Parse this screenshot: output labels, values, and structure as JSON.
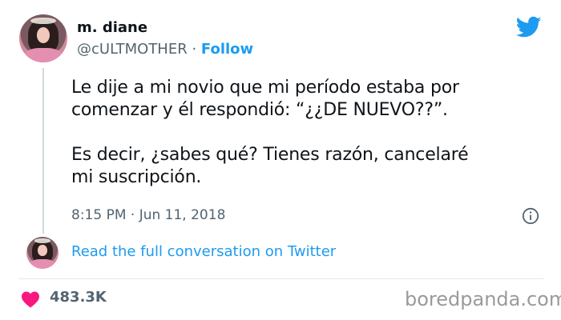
{
  "author": {
    "name": "m. diane",
    "handle": "@cULTMOTHER",
    "separator": " · ",
    "follow_label": "Follow"
  },
  "tweet": {
    "text": "Le dije a mi novio que mi período estaba por\ncomenzar y él respondió: “¿¿DE NUEVO??”.\n\nEs decir, ¿sabes qué? Tienes razón, cancelaré\nmi suscripción.",
    "timestamp": "8:15 PM · Jun 11, 2018"
  },
  "conversation_link": "Read the full conversation on Twitter",
  "likes": "483.3K",
  "watermark": "boredpanda.com",
  "colors": {
    "twitter_blue": "#1d9bf0",
    "heart": "#f91880",
    "muted": "#536471"
  },
  "icons": [
    "twitter-bird-icon",
    "info-icon",
    "heart-icon"
  ]
}
